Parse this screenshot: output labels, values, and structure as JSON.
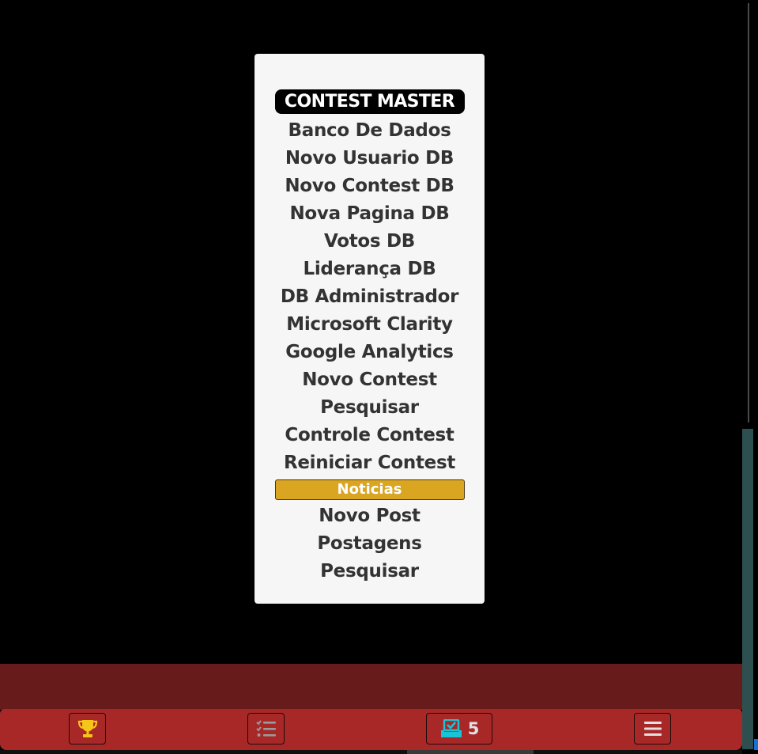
{
  "menu": {
    "title": "CONTEST MASTER",
    "items": [
      "Banco De Dados",
      "Novo Usuario DB",
      "Novo Contest DB",
      "Nova Pagina DB",
      "Votos DB",
      "Liderança DB",
      "DB Administrador",
      "Microsoft Clarity",
      "Google Analytics",
      "Novo Contest",
      "Pesquisar",
      "Controle Contest",
      "Reiniciar Contest"
    ],
    "section_title": "Noticias",
    "section_items": [
      "Novo Post",
      "Postagens",
      "Pesquisar"
    ]
  },
  "bottom_nav": {
    "trophy_icon": "trophy-icon",
    "tasks_icon": "checklist-icon",
    "votes_icon": "ballot-box-icon",
    "votes_count": "5",
    "menu_icon": "hamburger-menu-icon"
  },
  "colors": {
    "panel_bg": "#f6f6f6",
    "menu_text": "#333333",
    "section_accent": "#daa520",
    "nav_bar": "#a82828",
    "nav_band_dark": "#681b1b",
    "trophy": "#f5c518",
    "ballot": "#19c4d6"
  }
}
